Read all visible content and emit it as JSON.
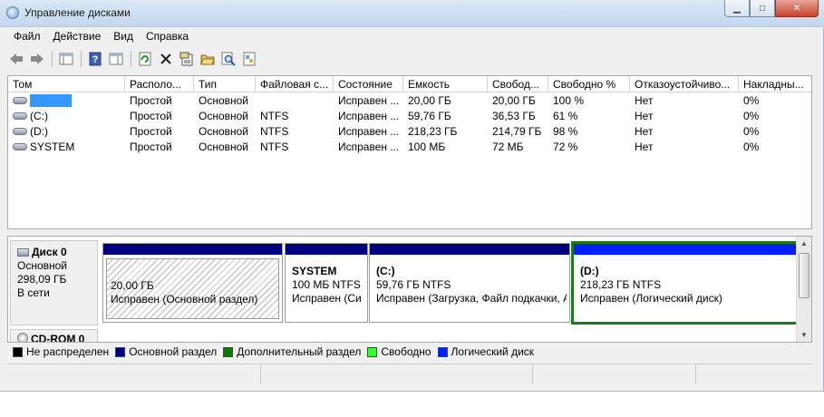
{
  "window": {
    "title": "Управление дисками"
  },
  "menu": [
    "Файл",
    "Действие",
    "Вид",
    "Справка"
  ],
  "toolbar": {
    "icons": [
      "back-arrow-icon",
      "forward-arrow-icon",
      "console-tree-icon",
      "help-icon",
      "properties-pane-icon",
      "refresh-icon",
      "delete-icon",
      "properties-icon",
      "open-folder-icon",
      "search-icon",
      "export-icon"
    ]
  },
  "volumes_table": {
    "columns": [
      "Том",
      "Располо...",
      "Тип",
      "Файловая с...",
      "Состояние",
      "Емкость",
      "Свобод...",
      "Свободно %",
      "Отказоустойчиво...",
      "Накладны..."
    ],
    "rows": [
      {
        "name": "",
        "selected": true,
        "layout": "Простой",
        "type": "Основной",
        "fs": "",
        "status": "Исправен ...",
        "capacity": "20,00 ГБ",
        "free": "20,00 ГБ",
        "free_pct": "100 %",
        "fault": "Нет",
        "overhead": "0%"
      },
      {
        "name": "(C:)",
        "selected": false,
        "layout": "Простой",
        "type": "Основной",
        "fs": "NTFS",
        "status": "Исправен ...",
        "capacity": "59,76 ГБ",
        "free": "36,53 ГБ",
        "free_pct": "61 %",
        "fault": "Нет",
        "overhead": "0%"
      },
      {
        "name": "(D:)",
        "selected": false,
        "layout": "Простой",
        "type": "Основной",
        "fs": "NTFS",
        "status": "Исправен ...",
        "capacity": "218,23 ГБ",
        "free": "214,79 ГБ",
        "free_pct": "98 %",
        "fault": "Нет",
        "overhead": "0%"
      },
      {
        "name": "SYSTEM",
        "selected": false,
        "layout": "Простой",
        "type": "Основной",
        "fs": "NTFS",
        "status": "Исправен ...",
        "capacity": "100 МБ",
        "free": "72 МБ",
        "free_pct": "72 %",
        "fault": "Нет",
        "overhead": "0%"
      }
    ]
  },
  "disk0": {
    "title": "Диск 0",
    "type": "Основной",
    "size": "298,09 ГБ",
    "status": "В сети",
    "partitions": [
      {
        "name": "",
        "size": "20,00 ГБ",
        "status": "Исправен (Основной раздел)"
      },
      {
        "name": "SYSTEM",
        "size": "100 МБ NTFS",
        "status": "Исправен (Си"
      },
      {
        "name": "(C:)",
        "size": "59,76 ГБ NTFS",
        "status": "Исправен (Загрузка, Файл подкачки, А"
      },
      {
        "name": "(D:)",
        "size": "218,23 ГБ NTFS",
        "status": "Исправен (Логический диск)"
      }
    ]
  },
  "cdrom": {
    "title": "CD-ROM 0"
  },
  "legend": [
    {
      "label": "Не распределен",
      "color": "#000000"
    },
    {
      "label": "Основной раздел",
      "color": "#000080"
    },
    {
      "label": "Дополнительный раздел",
      "color": "#008000"
    },
    {
      "label": "Свободно",
      "color": "#33ff33"
    },
    {
      "label": "Логический диск",
      "color": "#0020ff"
    }
  ]
}
